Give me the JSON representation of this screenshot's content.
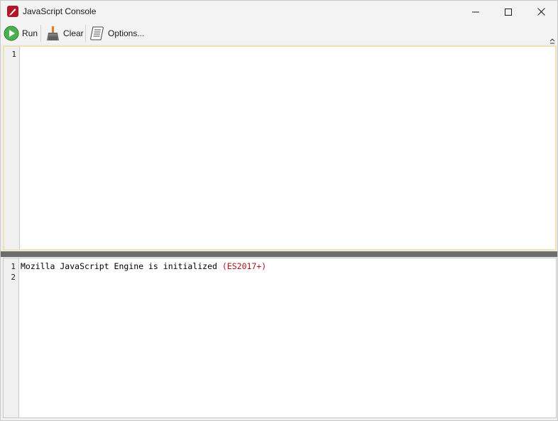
{
  "window": {
    "title": "JavaScript Console",
    "app_icon": "pdf-editor-icon",
    "controls": [
      "minimize-icon",
      "maximize-icon",
      "close-icon"
    ]
  },
  "toolbar": {
    "run_label": "Run",
    "run_icon": "play-icon",
    "clear_label": "Clear",
    "clear_icon": "broom-icon",
    "options_label": "Options...",
    "options_icon": "scroll-icon",
    "collapse_icon": "chevron-up-icon"
  },
  "editor": {
    "line_numbers": [
      "1"
    ],
    "content": ""
  },
  "output": {
    "line_numbers": [
      "1",
      "2"
    ],
    "message": "Mozilla JavaScript Engine is initialized ",
    "engine_version": "(ES2017+)"
  },
  "colors": {
    "accent_border": "#f0e0b8",
    "splitter": "#6d6d6d",
    "run_green": "#3a9a3a",
    "version_red": "#a31515"
  }
}
